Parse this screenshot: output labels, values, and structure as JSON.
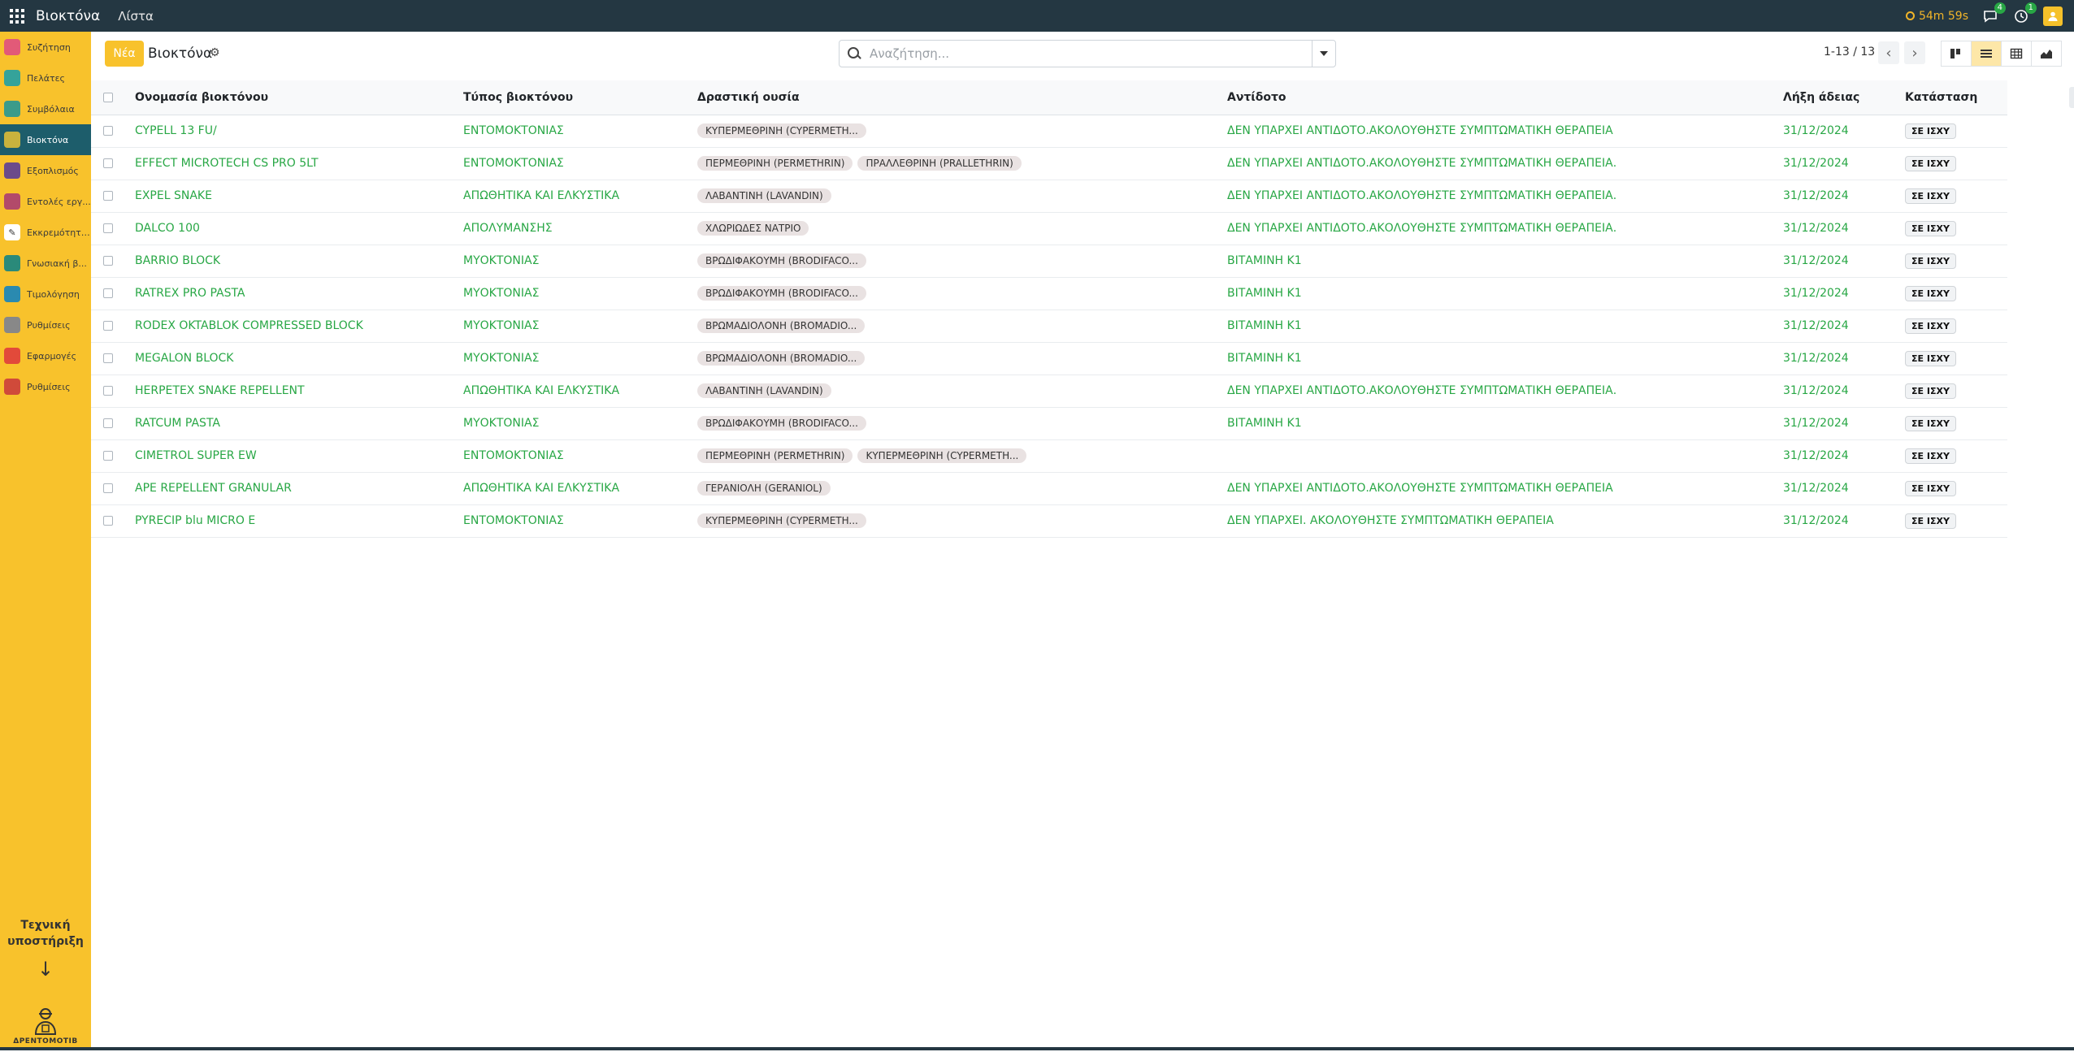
{
  "app": {
    "title": "Βιοκτόνα",
    "menu_item": "Λίστα",
    "timer": "54m 59s",
    "messages_count": "4",
    "activities_count": "1"
  },
  "sidebar": {
    "items": [
      {
        "label": "Συζήτηση",
        "icon": "chat-icon",
        "color": "#e25a78"
      },
      {
        "label": "Πελάτες",
        "icon": "contacts-icon",
        "color": "#35a39a"
      },
      {
        "label": "Συμβόλαια",
        "icon": "contract-icon",
        "color": "#3b9b8a"
      },
      {
        "label": "Βιοκτόνα",
        "icon": "biocide-icon",
        "color": "#c9b23d"
      },
      {
        "label": "Εξοπλισμός",
        "icon": "equipment-icon",
        "color": "#6b4b8a"
      },
      {
        "label": "Εντολές εργ...",
        "icon": "work-order-icon",
        "color": "#b24a6a"
      },
      {
        "label": "Εκκρεμότητες",
        "icon": "pending-icon",
        "color": "#ffffff"
      },
      {
        "label": "Γνωσιακή β...",
        "icon": "knowledge-icon",
        "color": "#2a8a7a"
      },
      {
        "label": "Τιμολόγηση",
        "icon": "invoicing-icon",
        "color": "#2a8ab0"
      },
      {
        "label": "Ρυθμίσεις",
        "icon": "settings-icon",
        "color": "#888888"
      },
      {
        "label": "Εφαρμογές",
        "icon": "apps-grid-icon",
        "color": "#e24a3a"
      },
      {
        "label": "Ρυθμίσεις",
        "icon": "settings-alt-icon",
        "color": "#d04a3a"
      }
    ],
    "support_title": "Τεχνική υποστήριξη",
    "support_arrow": "↓",
    "brand_name": "ΔΡΕΝΤΟΜΟΤΙΒ"
  },
  "control_panel": {
    "new_label": "Νέα",
    "title": "Βιοκτόνα",
    "search_placeholder": "Αναζήτηση...",
    "pager": "1-13 / 13"
  },
  "table": {
    "columns": [
      "Ονομασία βιοκτόνου",
      "Τύπος βιοκτόνου",
      "Δραστική ουσία",
      "Αντίδοτο",
      "Λήξη άδειας",
      "Κατάσταση"
    ],
    "rows": [
      {
        "name": "CYPELL 13 FU/",
        "type": "ΕΝΤΟΜΟΚΤΟΝΙΑΣ",
        "substances": [
          "ΚΥΠΕΡΜΕΘΡΙΝΗ (CYPERMETH..."
        ],
        "antidote": "ΔΕΝ ΥΠΑΡΧΕΙ ΑΝΤΙΔΟΤΟ.ΑΚΟΛΟΥΘΗΣΤΕ ΣΥΜΠΤΩΜΑΤΙΚΗ ΘΕΡΑΠΕΙΑ",
        "expiry": "31/12/2024",
        "status": "ΣΕ ΙΣΧΥ"
      },
      {
        "name": "EFFECT MICROTECH CS PRO 5LT",
        "type": "ΕΝΤΟΜΟΚΤΟΝΙΑΣ",
        "substances": [
          "ΠΕΡΜΕΘΡΙΝΗ (PERMETHRIN)",
          "ΠΡΑΛΛΕΘΡΙΝΗ (PRALLETHRIN)"
        ],
        "antidote": "ΔΕΝ ΥΠΑΡΧΕΙ ΑΝΤΙΔΟΤΟ.ΑΚΟΛΟΥΘΗΣΤΕ ΣΥΜΠΤΩΜΑΤΙΚΗ ΘΕΡΑΠΕΙΑ.",
        "expiry": "31/12/2024",
        "status": "ΣΕ ΙΣΧΥ"
      },
      {
        "name": "EXPEL SNAKE",
        "type": "ΑΠΩΘΗΤΙΚΑ ΚΑΙ ΕΛΚΥΣΤΙΚΑ",
        "substances": [
          "ΛΑΒΑΝΤΙΝΗ (LAVANDIN)"
        ],
        "antidote": "ΔΕΝ ΥΠΑΡΧΕΙ ΑΝΤΙΔΟΤΟ.ΑΚΟΛΟΥΘΗΣΤΕ ΣΥΜΠΤΩΜΑΤΙΚΗ ΘΕΡΑΠΕΙΑ.",
        "expiry": "31/12/2024",
        "status": "ΣΕ ΙΣΧΥ"
      },
      {
        "name": "DALCO 100",
        "type": "ΑΠΟΛΥΜΑΝΣΗΣ",
        "substances": [
          "ΧΛΩΡΙΩΔΕΣ ΝΑΤΡΙΟ"
        ],
        "antidote": "ΔΕΝ ΥΠΑΡΧΕΙ ΑΝΤΙΔΟΤΟ.ΑΚΟΛΟΥΘΗΣΤΕ ΣΥΜΠΤΩΜΑΤΙΚΗ ΘΕΡΑΠΕΙΑ.",
        "expiry": "31/12/2024",
        "status": "ΣΕ ΙΣΧΥ"
      },
      {
        "name": "BARRIO BLOCK",
        "type": "ΜΥΟΚΤΟΝΙΑΣ",
        "substances": [
          "ΒΡΩΔΙΦΑΚΟΥΜΗ (BRODIFACO..."
        ],
        "antidote": "ΒΙΤΑΜΙΝΗ Κ1",
        "expiry": "31/12/2024",
        "status": "ΣΕ ΙΣΧΥ"
      },
      {
        "name": "RATREX PRO PASTA",
        "type": "ΜΥΟΚΤΟΝΙΑΣ",
        "substances": [
          "ΒΡΩΔΙΦΑΚΟΥΜΗ (BRODIFACO..."
        ],
        "antidote": "ΒΙΤΑΜΙΝΗ Κ1",
        "expiry": "31/12/2024",
        "status": "ΣΕ ΙΣΧΥ"
      },
      {
        "name": "RODEX OKTABLOK COMPRESSED BLOCK",
        "type": "ΜΥΟΚΤΟΝΙΑΣ",
        "substances": [
          "ΒΡΩΜΑΔΙΟΛΟΝΗ (BROMADIO..."
        ],
        "antidote": "ΒΙΤΑΜΙΝΗ Κ1",
        "expiry": "31/12/2024",
        "status": "ΣΕ ΙΣΧΥ"
      },
      {
        "name": "MEGALON BLOCK",
        "type": "ΜΥΟΚΤΟΝΙΑΣ",
        "substances": [
          "ΒΡΩΜΑΔΙΟΛΟΝΗ (BROMADIO..."
        ],
        "antidote": "ΒΙΤΑΜΙΝΗ Κ1",
        "expiry": "31/12/2024",
        "status": "ΣΕ ΙΣΧΥ"
      },
      {
        "name": "HERPETEX SNAKE REPELLENT",
        "type": "ΑΠΩΘΗΤΙΚΑ ΚΑΙ ΕΛΚΥΣΤΙΚΑ",
        "substances": [
          "ΛΑΒΑΝΤΙΝΗ (LAVANDIN)"
        ],
        "antidote": "ΔΕΝ ΥΠΑΡΧΕΙ ΑΝΤΙΔΟΤΟ.ΑΚΟΛΟΥΘΗΣΤΕ ΣΥΜΠΤΩΜΑΤΙΚΗ ΘΕΡΑΠΕΙΑ.",
        "expiry": "31/12/2024",
        "status": "ΣΕ ΙΣΧΥ"
      },
      {
        "name": "RATCUM PASTA",
        "type": "ΜΥΟΚΤΟΝΙΑΣ",
        "substances": [
          "ΒΡΩΔΙΦΑΚΟΥΜΗ (BRODIFACO..."
        ],
        "antidote": "ΒΙΤΑΜΙΝΗ Κ1",
        "expiry": "31/12/2024",
        "status": "ΣΕ ΙΣΧΥ"
      },
      {
        "name": "CIMETROL SUPER EW",
        "type": "ΕΝΤΟΜΟΚΤΟΝΙΑΣ",
        "substances": [
          "ΠΕΡΜΕΘΡΙΝΗ (PERMETHRIN)",
          "ΚΥΠΕΡΜΕΘΡΙΝΗ (CYPERMETH..."
        ],
        "antidote": "",
        "expiry": "31/12/2024",
        "status": "ΣΕ ΙΣΧΥ"
      },
      {
        "name": "APE REPELLENT GRANULAR",
        "type": "ΑΠΩΘΗΤΙΚΑ ΚΑΙ ΕΛΚΥΣΤΙΚΑ",
        "substances": [
          "ΓΕΡΑΝΙΟΛΗ (GERANIOL)"
        ],
        "antidote": "ΔΕΝ ΥΠΑΡΧΕΙ ΑΝΤΙΔΟΤΟ.ΑΚΟΛΟΥΘΗΣΤΕ ΣΥΜΠΤΩΜΑΤΙΚΗ ΘΕΡΑΠΕΙΑ",
        "expiry": "31/12/2024",
        "status": "ΣΕ ΙΣΧΥ"
      },
      {
        "name": "PYRECIP blu MICRO E",
        "type": "ΕΝΤΟΜΟΚΤΟΝΙΑΣ",
        "substances": [
          "ΚΥΠΕΡΜΕΘΡΙΝΗ (CYPERMETH..."
        ],
        "antidote": "ΔΕΝ ΥΠΑΡΧΕΙ. ΑΚΟΛΟΥΘΗΣΤΕ ΣΥΜΠΤΩΜΑΤΙΚΗ ΘΕΡΑΠΕΙΑ",
        "expiry": "31/12/2024",
        "status": "ΣΕ ΙΣΧΥ"
      }
    ]
  },
  "colors": {
    "topbar": "#243742",
    "accent": "#f8c22c",
    "link_green": "#28a745",
    "sidebar_active": "#1d5d6b"
  }
}
